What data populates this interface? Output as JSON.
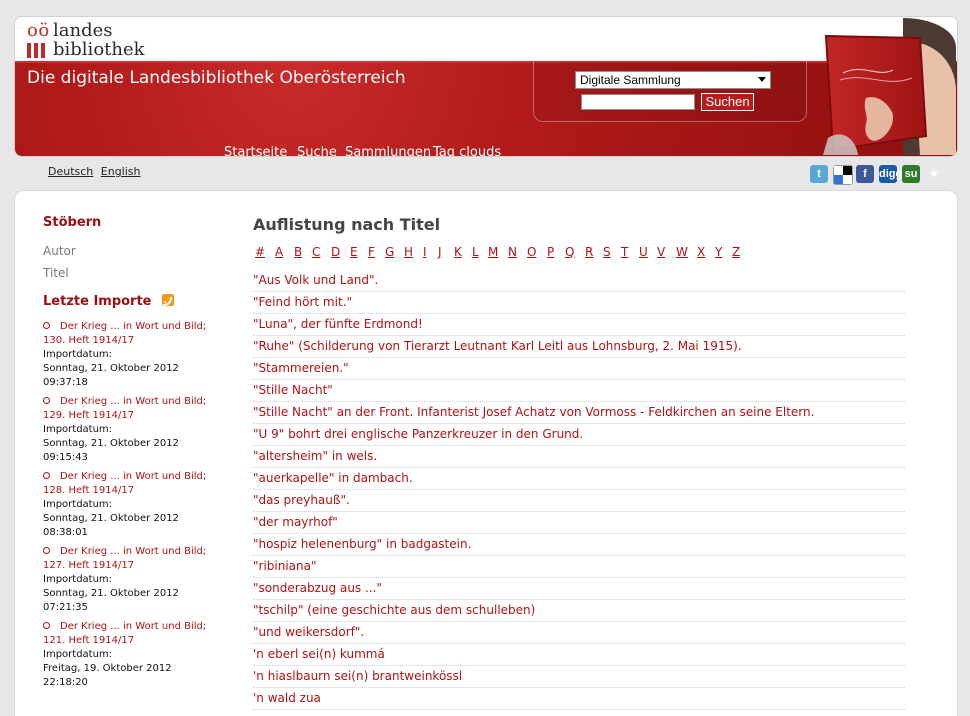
{
  "logo": {
    "prefix": "oö",
    "line1": "landes",
    "line2": "bibliothek"
  },
  "header": {
    "title": "Die digitale Landesbibliothek Oberösterreich"
  },
  "search": {
    "select_value": "Digitale Sammlung",
    "input_value": "",
    "button_label": "Suchen"
  },
  "nav": [
    "Startseite",
    "Suche",
    "Sammlungen",
    "Tag clouds"
  ],
  "lang": [
    "Deutsch",
    "English"
  ],
  "social": [
    {
      "name": "twitter-icon",
      "glyph": "t"
    },
    {
      "name": "delicious-icon",
      "glyph": ""
    },
    {
      "name": "facebook-icon",
      "glyph": "f"
    },
    {
      "name": "digg-icon",
      "glyph": "digg"
    },
    {
      "name": "stumbleupon-icon",
      "glyph": "su"
    },
    {
      "name": "favorite-star-icon",
      "glyph": "★"
    }
  ],
  "sidebar": {
    "browse_title": "Stöbern",
    "browse_links": [
      "Autor",
      "Titel"
    ],
    "imports_title": "Letzte Importe",
    "imports": [
      {
        "title1": "Der Krieg ... in Wort und Bild;",
        "title2": "130. Heft 1914/17",
        "label": "Importdatum:",
        "date": "Sonntag, 21. Oktober 2012",
        "time": "09:37:18"
      },
      {
        "title1": "Der Krieg ... in Wort und Bild;",
        "title2": "129. Heft 1914/17",
        "label": "Importdatum:",
        "date": "Sonntag, 21. Oktober 2012",
        "time": "09:15:43"
      },
      {
        "title1": "Der Krieg ... in Wort und Bild;",
        "title2": "128. Heft 1914/17",
        "label": "Importdatum:",
        "date": "Sonntag, 21. Oktober 2012",
        "time": "08:38:01"
      },
      {
        "title1": "Der Krieg ... in Wort und Bild;",
        "title2": "127. Heft 1914/17",
        "label": "Importdatum:",
        "date": "Sonntag, 21. Oktober 2012",
        "time": "07:21:35"
      },
      {
        "title1": "Der Krieg ... in Wort und Bild;",
        "title2": "121. Heft 1914/17",
        "label": "Importdatum:",
        "date": "Freitag, 19. Oktober 2012",
        "time": "22:18:20"
      }
    ]
  },
  "main": {
    "title": "Auflistung nach Titel",
    "alphabet": [
      "#",
      "A",
      "B",
      "C",
      "D",
      "E",
      "F",
      "G",
      "H",
      "I",
      "J",
      "K",
      "L",
      "M",
      "N",
      "O",
      "P",
      "Q",
      "R",
      "S",
      "T",
      "U",
      "V",
      "W",
      "X",
      "Y",
      "Z"
    ],
    "titles": [
      "\"Aus Volk und Land\".",
      "\"Feind hört mit.\"",
      "\"Luna\", der fünfte Erdmond!",
      "\"Ruhe\" (Schilderung von Tierarzt Leutnant Karl Leitl aus Lohnsburg, 2. Mai 1915).",
      "\"Stammereien.\"",
      "\"Stille Nacht\"",
      "\"Stille Nacht\" an der Front. Infanterist Josef Achatz von Vormoss - Feldkirchen an seine Eltern.",
      "\"U 9\" bohrt drei englische Panzerkreuzer in den Grund.",
      "\"altersheim\" in wels.",
      "\"auerkapelle\" in dambach.",
      "\"das preyhauß\".",
      "\"der mayrhof\"",
      "\"hospiz helenenburg\" in badgastein.",
      "\"ribiniana\"",
      "\"sonderabzug aus ...\"",
      "\"tschilp\" (eine geschichte aus dem schulleben)",
      "\"und weikersdorf\".",
      "'n eberl sei(n) kummá",
      "'n hiaslbaurn sei(n) brantweinkössl",
      "'n wald zua"
    ]
  },
  "colors": {
    "brand_red": "#b01214",
    "header_red_dark": "#8d0f0f",
    "header_red_light": "#c92a2a"
  }
}
